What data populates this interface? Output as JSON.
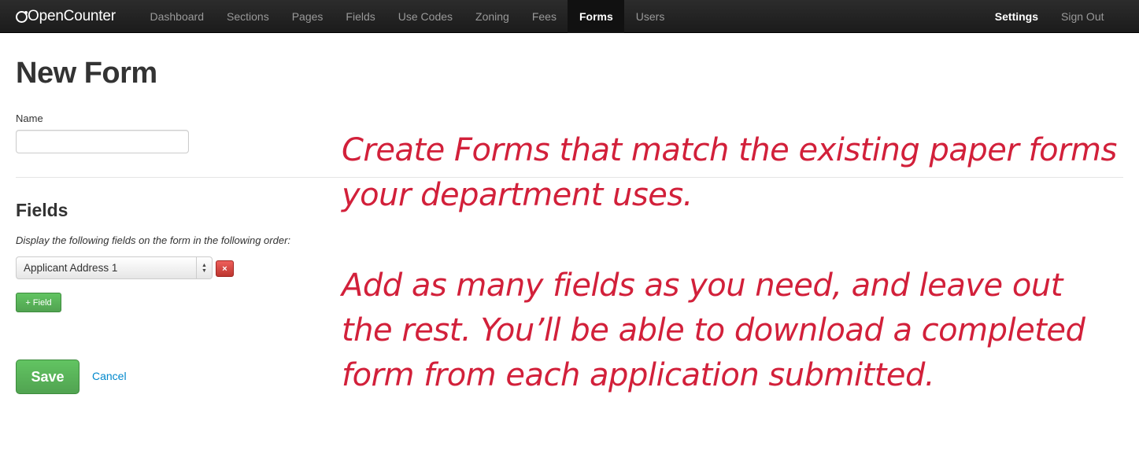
{
  "app": {
    "brand": "OpenCounter"
  },
  "nav": {
    "left_items": [
      {
        "label": "Dashboard"
      },
      {
        "label": "Sections"
      },
      {
        "label": "Pages"
      },
      {
        "label": "Fields"
      },
      {
        "label": "Use Codes"
      },
      {
        "label": "Zoning"
      },
      {
        "label": "Fees"
      },
      {
        "label": "Forms"
      },
      {
        "label": "Users"
      }
    ],
    "active": "Forms",
    "right_items": [
      {
        "label": "Settings"
      },
      {
        "label": "Sign Out"
      }
    ]
  },
  "page": {
    "title": "New Form",
    "name_label": "Name",
    "name_value": "",
    "fields_title": "Fields",
    "fields_help": "Display the following fields on the form in the following order:",
    "field_selected": "Applicant Address 1",
    "remove_label": "×",
    "add_field_label": "+ Field",
    "save_label": "Save",
    "cancel_label": "Cancel"
  },
  "annotations": {
    "note_1": "Create Forms that match the existing paper forms your department uses.",
    "note_2": "Add as many fields as you need, and leave out the rest. You’ll be able to download a completed form from each application submitted.",
    "color": "#d2203a"
  },
  "colors": {
    "navbar": "#1b1b1b",
    "link": "#0088cc",
    "success": "#51a351",
    "danger": "#bd362f"
  }
}
